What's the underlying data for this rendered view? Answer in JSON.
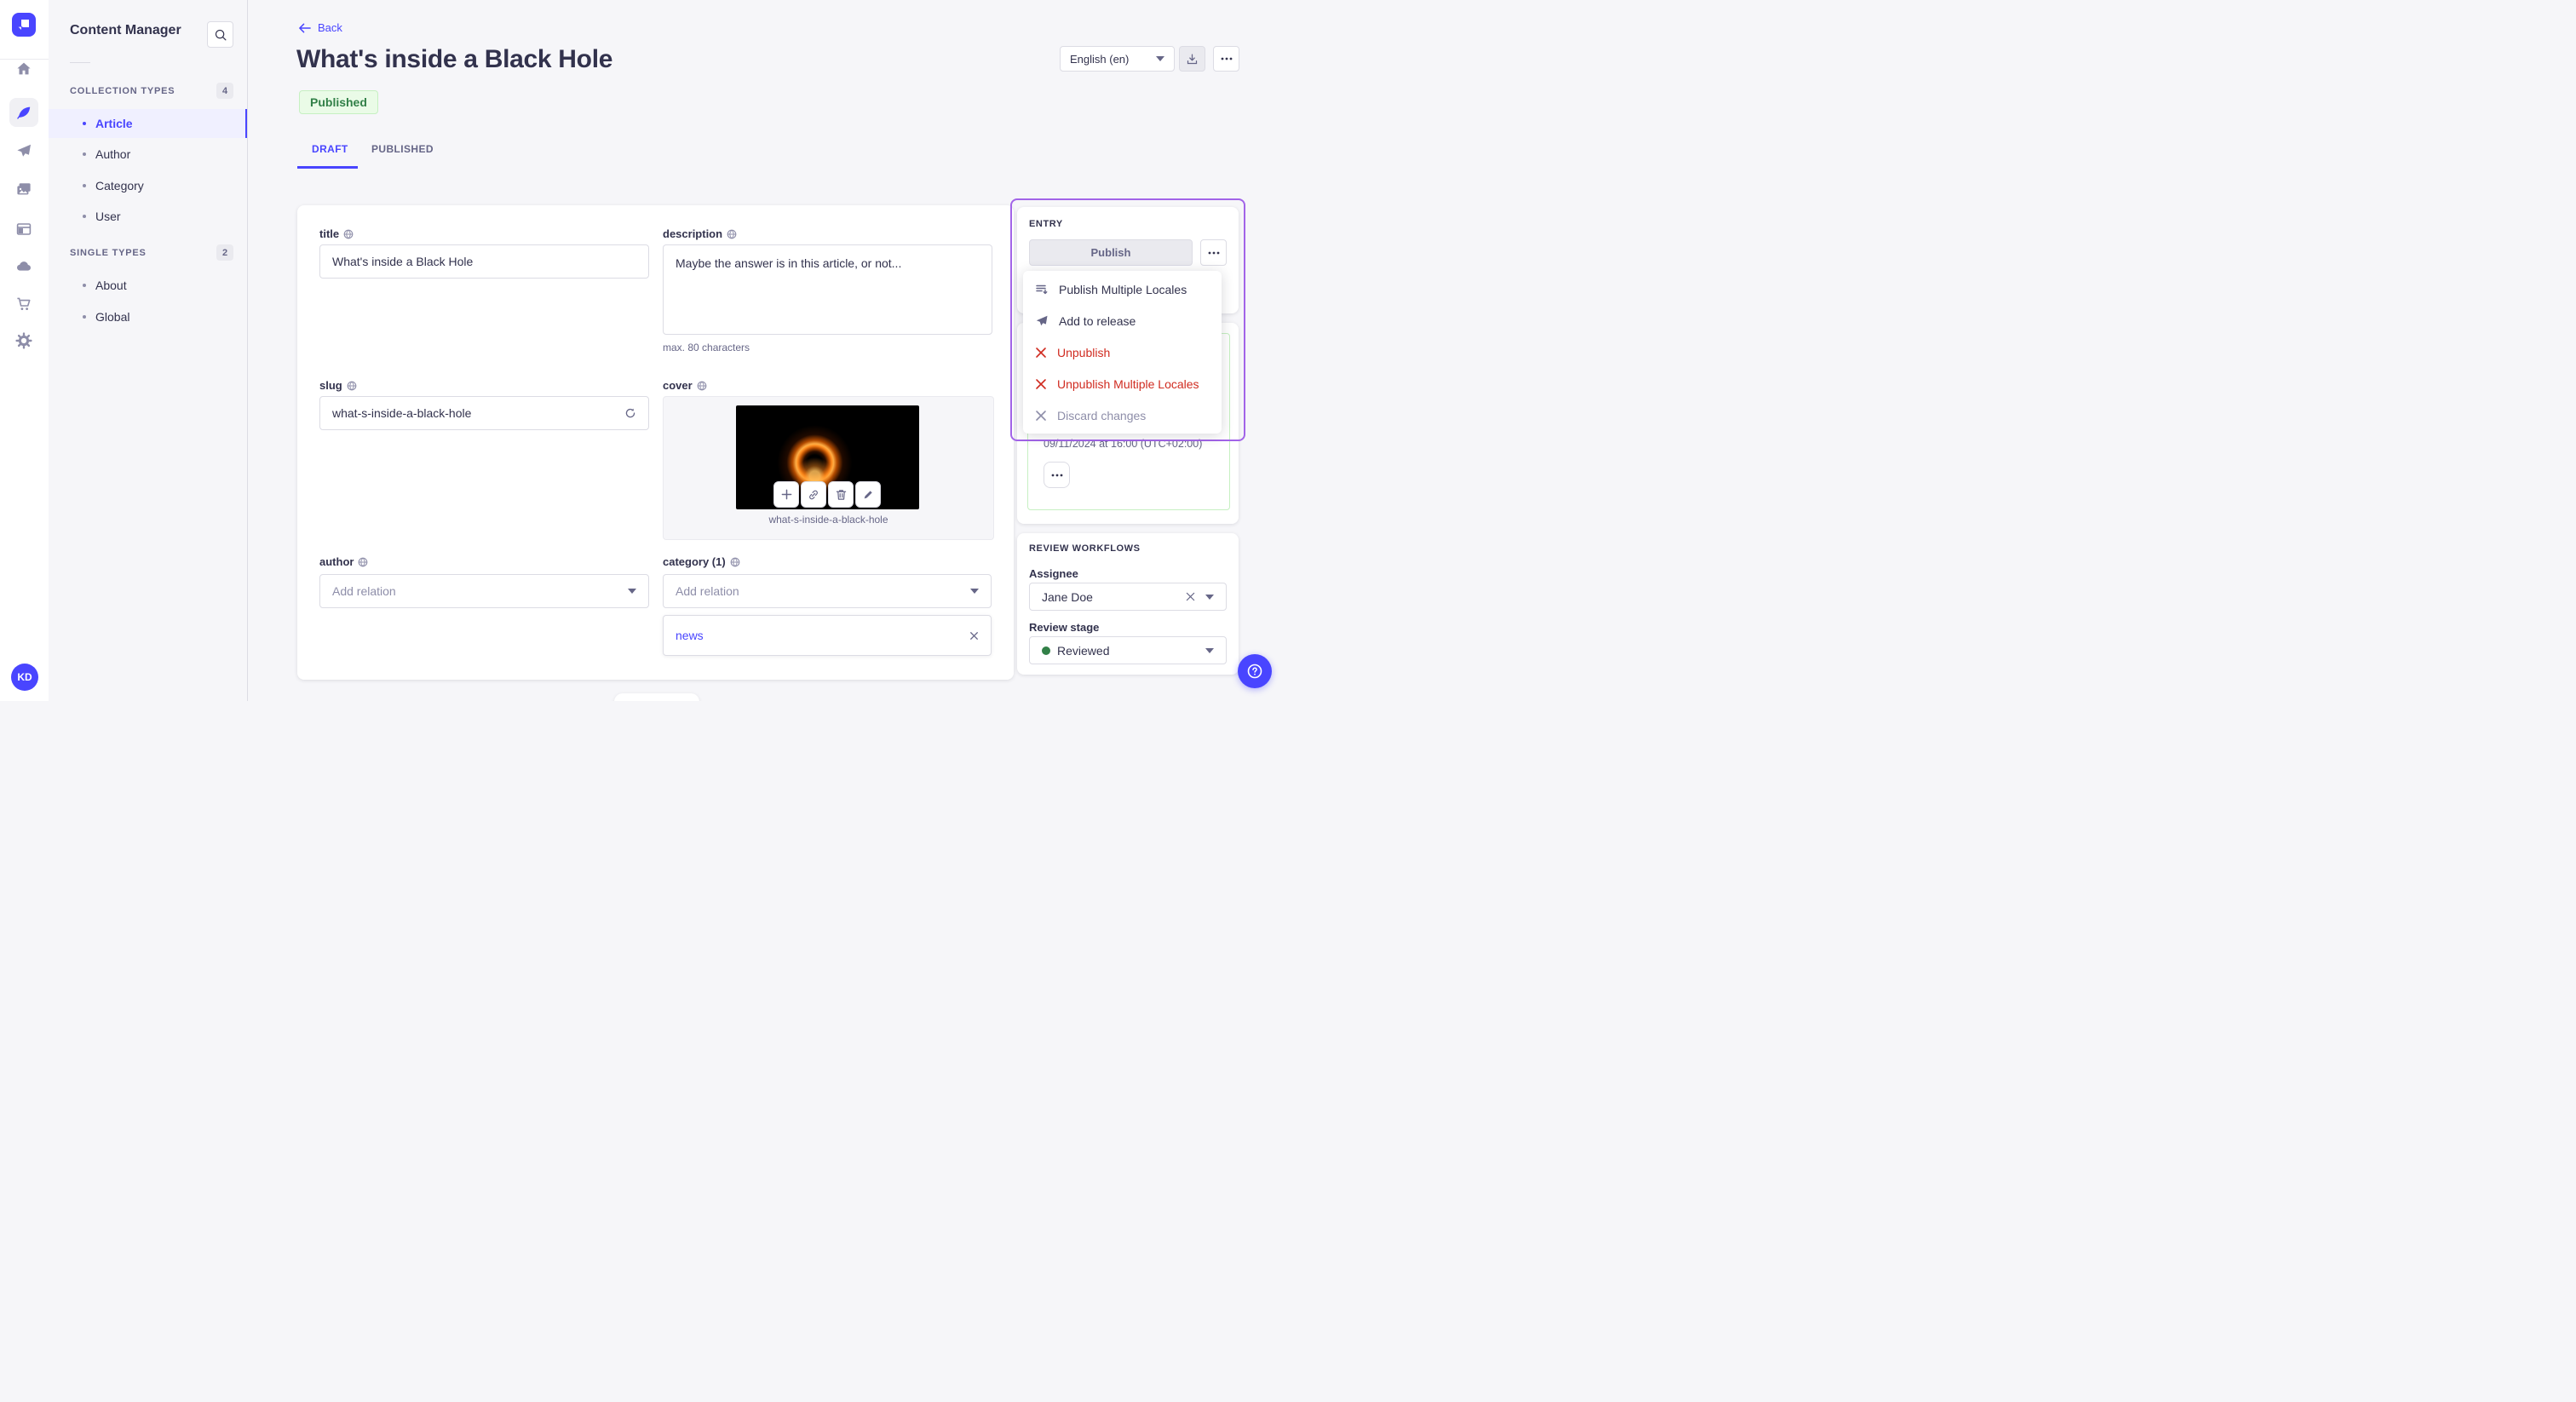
{
  "colors": {
    "primary": "#4945ff",
    "text": "#32324d",
    "muted": "#666687",
    "subtle": "#8e8ea9",
    "border": "#dcdce4",
    "divider": "#eaeaef",
    "background": "#f6f6f9",
    "card": "#ffffff",
    "danger": "#d02b20",
    "success_text": "#328048",
    "success_bg": "#eafbe7",
    "success_border": "#c6f0c2",
    "highlight_border": "#a264e8",
    "disabled_bg": "#eaeaef"
  },
  "rail": {
    "logo_icon": "strapi-logo-icon",
    "items": [
      {
        "icon": "home-icon",
        "active": false
      },
      {
        "icon": "content-manager-feather-icon",
        "active": true
      },
      {
        "icon": "releases-paper-plane-icon",
        "active": false
      },
      {
        "icon": "media-library-images-icon",
        "active": false
      },
      {
        "icon": "content-type-builder-layout-icon",
        "active": false
      },
      {
        "icon": "cloud-icon",
        "active": false
      },
      {
        "icon": "marketplace-cart-icon",
        "active": false
      },
      {
        "icon": "settings-gear-icon",
        "active": false
      }
    ],
    "user_initials": "KD"
  },
  "subnav": {
    "title": "Content Manager",
    "sections": [
      {
        "label": "COLLECTION TYPES",
        "count": "4",
        "items": [
          {
            "label": "Article",
            "active": true
          },
          {
            "label": "Author",
            "active": false
          },
          {
            "label": "Category",
            "active": false
          },
          {
            "label": "User",
            "active": false
          }
        ]
      },
      {
        "label": "SINGLE TYPES",
        "count": "2",
        "items": [
          {
            "label": "About",
            "active": false
          },
          {
            "label": "Global",
            "active": false
          }
        ]
      }
    ]
  },
  "header": {
    "back": "Back",
    "title": "What's inside a Black Hole",
    "status": "Published",
    "locale": "English (en)",
    "tabs": [
      {
        "label": "DRAFT",
        "active": true
      },
      {
        "label": "PUBLISHED",
        "active": false
      }
    ]
  },
  "form": {
    "title": {
      "label": "title",
      "value": "What's inside a Black Hole"
    },
    "description": {
      "label": "description",
      "value": "Maybe the answer is in this article, or not...",
      "hint": "max. 80 characters"
    },
    "slug": {
      "label": "slug",
      "value": "what-s-inside-a-black-hole"
    },
    "cover": {
      "label": "cover",
      "filename": "what-s-inside-a-black-hole"
    },
    "author": {
      "label": "author",
      "placeholder": "Add relation"
    },
    "category": {
      "label": "category (1)",
      "placeholder": "Add relation",
      "tag": "news"
    }
  },
  "entry": {
    "title": "ENTRY",
    "publish_label": "Publish",
    "menu": [
      {
        "label": "Publish Multiple Locales",
        "icon": "publish-multiple-locales-icon",
        "variant": "default"
      },
      {
        "label": "Add to release",
        "icon": "add-to-release-icon",
        "variant": "default"
      },
      {
        "label": "Unpublish",
        "icon": "cross-icon",
        "variant": "danger"
      },
      {
        "label": "Unpublish Multiple Locales",
        "icon": "cross-icon",
        "variant": "danger"
      },
      {
        "label": "Discard changes",
        "icon": "cross-icon",
        "variant": "disabled"
      }
    ],
    "schedule": "09/11/2024 at 16:00 (UTC+02:00)"
  },
  "review": {
    "title": "REVIEW WORKFLOWS",
    "assignee_label": "Assignee",
    "assignee_value": "Jane Doe",
    "stage_label": "Review stage",
    "stage_value": "Reviewed"
  }
}
